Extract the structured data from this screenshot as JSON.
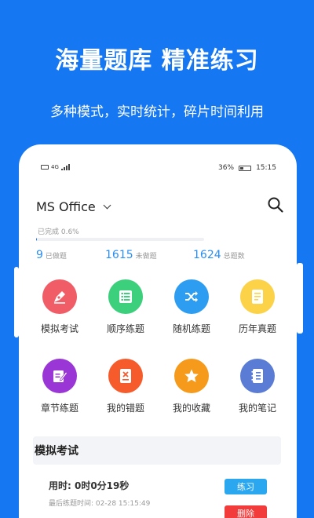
{
  "promo": {
    "headline": "海量题库 精准练习",
    "subline": "多种模式，实时统计，碎片时间利用"
  },
  "status_bar": {
    "network": "4G",
    "battery": "36%",
    "time": "15:15"
  },
  "header": {
    "title": "MS Office",
    "search_icon": "search-icon"
  },
  "progress": {
    "label": "已完成 0.6%",
    "percent": 0.6
  },
  "stats": [
    {
      "value": "9",
      "label": "已做题"
    },
    {
      "value": "1615",
      "label": "未做题"
    },
    {
      "value": "1624",
      "label": "总题数"
    }
  ],
  "features_row1": [
    {
      "label": "模拟考试",
      "icon": "pen-icon",
      "color": "#f05d66"
    },
    {
      "label": "顺序练题",
      "icon": "list-icon",
      "color": "#3ccf7c"
    },
    {
      "label": "随机练题",
      "icon": "shuffle-icon",
      "color": "#2d9df2"
    },
    {
      "label": "历年真题",
      "icon": "document-icon",
      "color": "#fbd248"
    }
  ],
  "features_row2": [
    {
      "label": "章节练题",
      "icon": "edit-icon",
      "color": "#9b36d6"
    },
    {
      "label": "我的错题",
      "icon": "wrong-book-icon",
      "color": "#f65b2c"
    },
    {
      "label": "我的收藏",
      "icon": "star-icon",
      "color": "#f59a1b"
    },
    {
      "label": "我的笔记",
      "icon": "notebook-icon",
      "color": "#5a7cd4"
    }
  ],
  "exam_section": {
    "title": "模拟考试",
    "record": {
      "time_used": "用时: 0时0分19秒",
      "last_practice": "最后练题时间: 02-28 15:15:49",
      "practice_button": "练习",
      "delete_button": "删除"
    }
  }
}
